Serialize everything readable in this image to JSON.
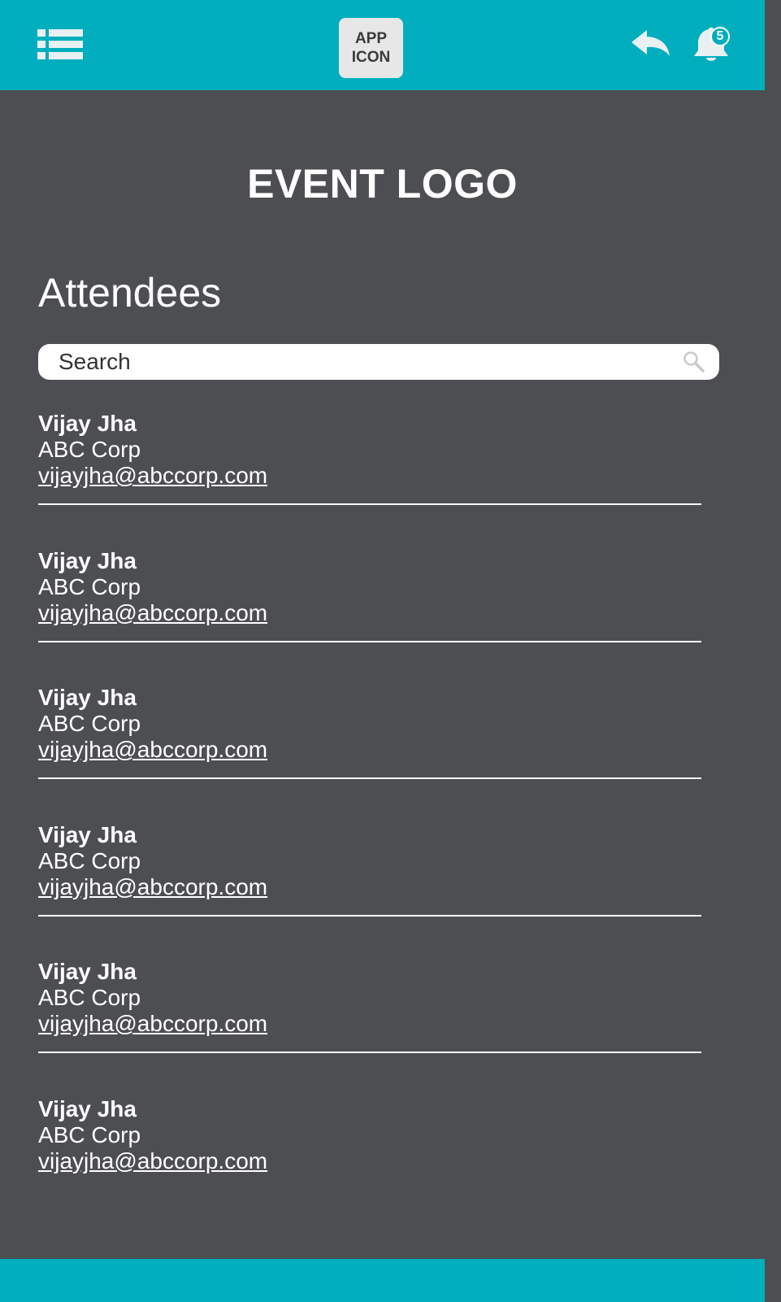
{
  "header": {
    "app_icon_line1": "APP",
    "app_icon_line2": "ICON",
    "notification_count": "5",
    "brand_color": "#01aebd"
  },
  "icons": {
    "menu": "list-menu-icon",
    "back": "reply-back-icon",
    "notifications": "bell-icon",
    "search": "magnifier-icon"
  },
  "event": {
    "logo_text": "EVENT LOGO"
  },
  "page": {
    "title": "Attendees"
  },
  "search": {
    "placeholder": "Search",
    "value": ""
  },
  "attendees": [
    {
      "name": "Vijay Jha",
      "company": "ABC Corp",
      "email": "vijayjha@abccorp.com"
    },
    {
      "name": "Vijay Jha",
      "company": "ABC Corp",
      "email": "vijayjha@abccorp.com"
    },
    {
      "name": "Vijay Jha",
      "company": "ABC Corp",
      "email": "vijayjha@abccorp.com"
    },
    {
      "name": "Vijay Jha",
      "company": "ABC Corp",
      "email": "vijayjha@abccorp.com"
    },
    {
      "name": "Vijay Jha",
      "company": "ABC Corp",
      "email": "vijayjha@abccorp.com"
    },
    {
      "name": "Vijay Jha",
      "company": "ABC Corp",
      "email": "vijayjha@abccorp.com"
    }
  ]
}
